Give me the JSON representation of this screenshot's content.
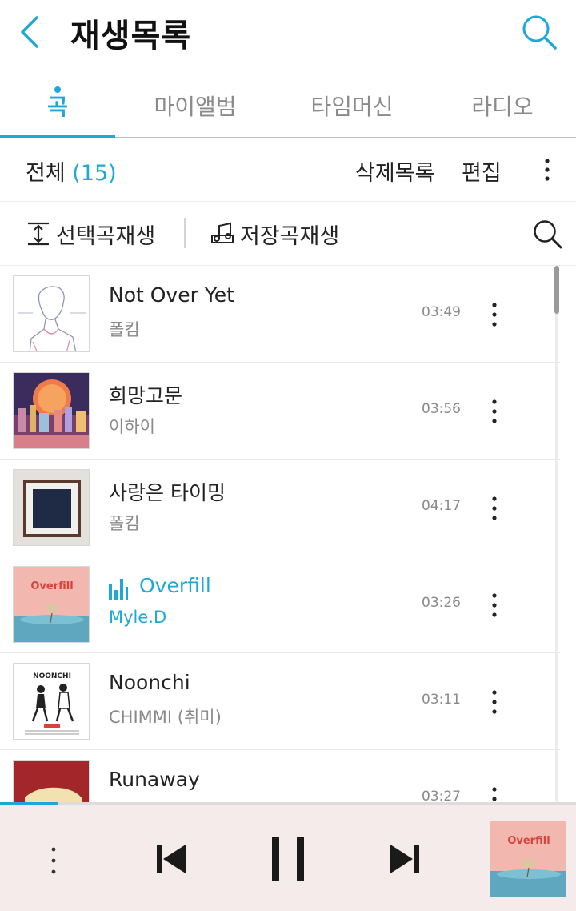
{
  "header": {
    "title": "재생목록",
    "back_icon": "chevron-left-icon",
    "search_icon": "search-icon"
  },
  "tabs": [
    {
      "label": "곡",
      "active": true
    },
    {
      "label": "마이앨범",
      "active": false
    },
    {
      "label": "타임머신",
      "active": false
    },
    {
      "label": "라디오",
      "active": false
    }
  ],
  "toolbar": {
    "all_label": "전체",
    "count": "(15)",
    "deleted_label": "삭제목록",
    "edit_label": "편집"
  },
  "actions": {
    "select_play_label": "선택곡재생",
    "saved_play_label": "저장곡재생"
  },
  "songs": [
    {
      "title": "Not Over Yet",
      "artist": "폴킴",
      "duration": "03:49",
      "playing": false
    },
    {
      "title": "희망고문",
      "artist": "이하이",
      "duration": "03:56",
      "playing": false
    },
    {
      "title": "사랑은 타이밍",
      "artist": "폴킴",
      "duration": "04:17",
      "playing": false
    },
    {
      "title": "Overfill",
      "artist": "Myle.D",
      "duration": "03:26",
      "playing": true
    },
    {
      "title": "Noonchi",
      "artist": "CHIMMI (취미)",
      "duration": "03:11",
      "playing": false
    },
    {
      "title": "Runaway",
      "artist": "",
      "duration": "03:27",
      "playing": false
    }
  ],
  "album_text": {
    "overfill": "Overfill",
    "noonchi": "NOONCHI"
  },
  "player": {
    "progress": 0.1,
    "state": "playing"
  },
  "colors": {
    "accent": "#1ea8d8",
    "player_bg": "#f6ebeb"
  }
}
